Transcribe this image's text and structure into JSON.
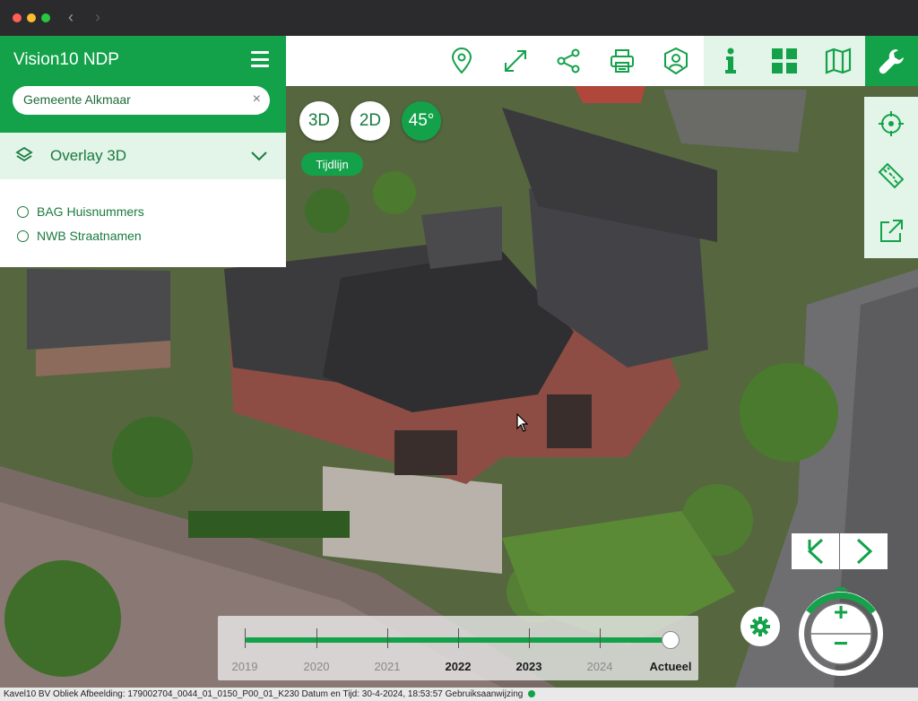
{
  "window": {
    "back_arrow": "‹",
    "forward_arrow": "›"
  },
  "panel": {
    "title": "Vision10 NDP",
    "menu_icon": "hamburger-icon",
    "search": {
      "value": "Gemeente Alkmaar",
      "clear_glyph": "×"
    },
    "overlay": {
      "label": "Overlay 3D",
      "icon": "layers-icon",
      "expanded_icon": "chevron-down-icon"
    },
    "layers": [
      {
        "label": "BAG Huisnummers",
        "selected": false
      },
      {
        "label": "NWB Straatnamen",
        "selected": false
      }
    ]
  },
  "toolbar": {
    "items": [
      "location-pin-icon",
      "fullscreen-icon",
      "share-icon",
      "print-icon",
      "user-shield-icon",
      "info-icon",
      "grid-icon",
      "map-book-icon",
      "wrench-icon"
    ]
  },
  "view_modes": {
    "buttons": [
      {
        "label": "3D",
        "active": false
      },
      {
        "label": "2D",
        "active": false
      },
      {
        "label": "45°",
        "active": true
      }
    ],
    "timeline_button": "Tijdlijn"
  },
  "side_tools": [
    "crosshair-icon",
    "ruler-icon",
    "external-link-icon"
  ],
  "navigation": {
    "rotate_left_icon": "rotate-left-icon",
    "rotate_right_icon": "rotate-right-icon",
    "zoom_in": "+",
    "zoom_out": "−",
    "settings_icon": "gear-icon"
  },
  "timeline": {
    "labels": [
      {
        "text": "2019",
        "bold": false
      },
      {
        "text": "2020",
        "bold": false
      },
      {
        "text": "2021",
        "bold": false
      },
      {
        "text": "2022",
        "bold": true
      },
      {
        "text": "2023",
        "bold": true
      },
      {
        "text": "2024",
        "bold": false
      },
      {
        "text": "Actueel",
        "bold": true
      }
    ],
    "selected": "Actueel"
  },
  "statusbar": {
    "text": "Kavel10 BV  Obliek Afbeelding: 179002704_0044_01_0150_P00_01_K230  Datum en Tijd: 30-4-2024, 18:53:57  Gebruiksaanwijzing"
  },
  "colors": {
    "brand": "#13a24a",
    "brand_light": "#e3f5e8",
    "text_green": "#1a7a40"
  }
}
